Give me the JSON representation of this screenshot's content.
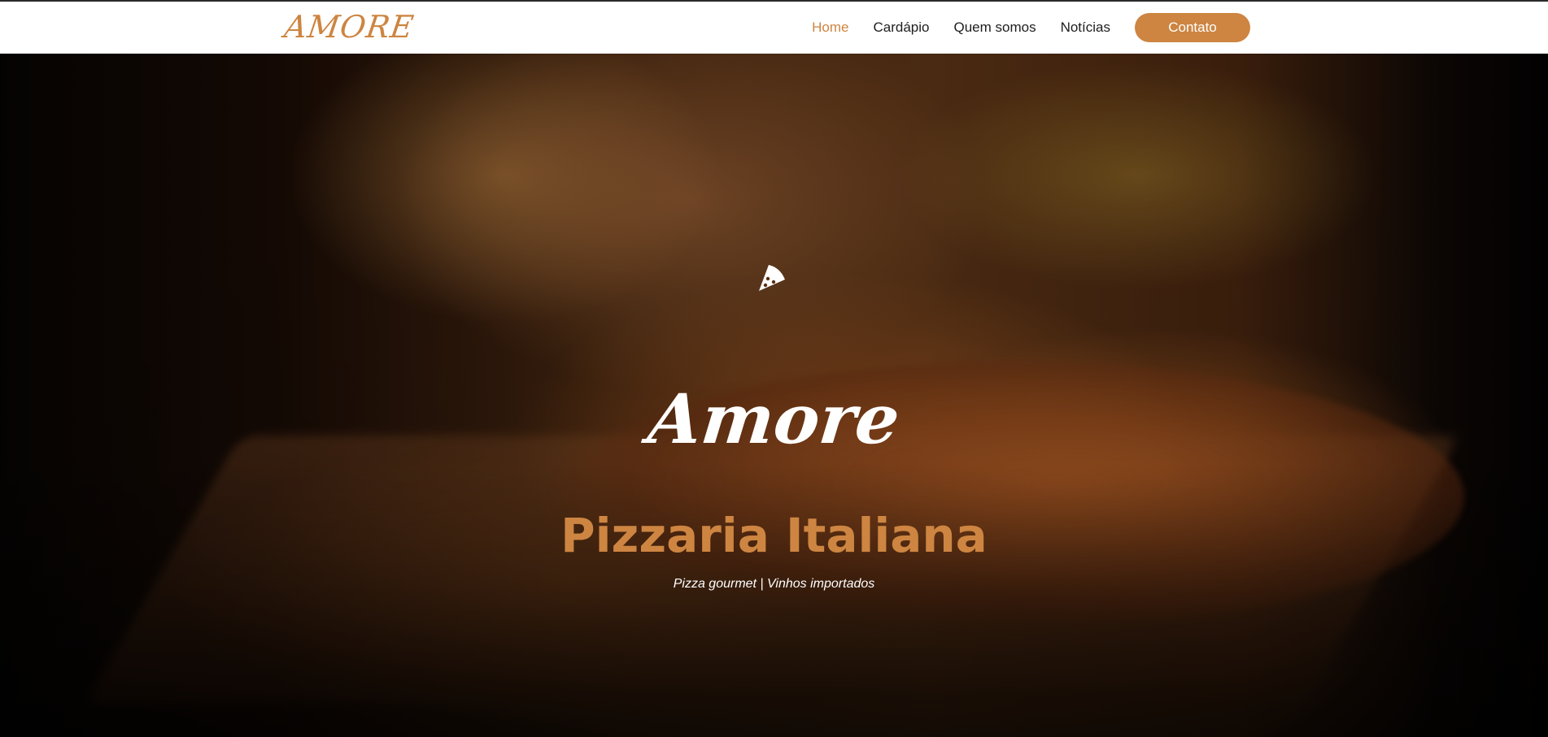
{
  "brand": {
    "logo_text": "AMORE",
    "accent_color": "#cd8541"
  },
  "nav": {
    "items": [
      {
        "label": "Home",
        "active": true
      },
      {
        "label": "Cardápio",
        "active": false
      },
      {
        "label": "Quem somos",
        "active": false
      },
      {
        "label": "Notícias",
        "active": false
      }
    ],
    "cta_label": "Contato"
  },
  "hero": {
    "icon": "pizza-slice-icon",
    "script_title": "Amore",
    "title": "Pizzaria Italiana",
    "subtitle": "Pizza gourmet | Vinhos importados"
  }
}
